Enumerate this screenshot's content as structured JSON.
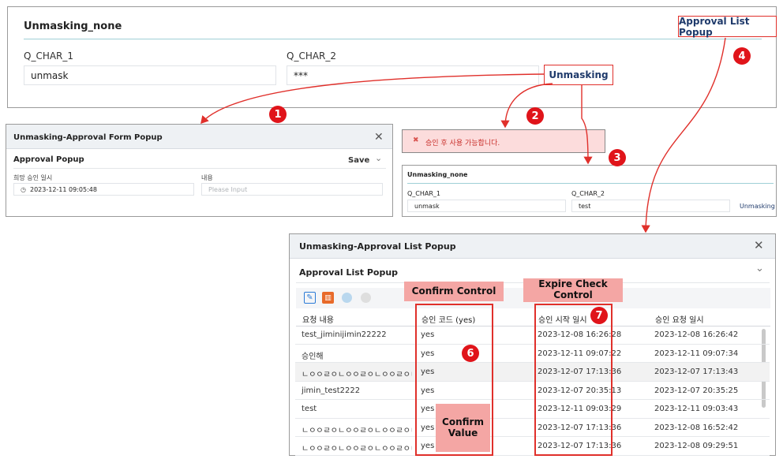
{
  "top_form": {
    "title": "Unmasking_none",
    "field1_label": "Q_CHAR_1",
    "field1_value": "unmask",
    "field2_label": "Q_CHAR_2",
    "field2_value": "***"
  },
  "annotations": {
    "approval_list_popup_btn": "Approval List Popup",
    "unmasking_btn": "Unmasking",
    "confirm_control": "Confirm Control",
    "expire_check_control": "Expire Check Control",
    "confirm_value": "Confirm Value",
    "badges": [
      "1",
      "2",
      "3",
      "4",
      "6",
      "7"
    ]
  },
  "form_popup": {
    "window_title": "Unmasking-Approval Form Popup",
    "section_title": "Approval Popup",
    "save_label": "Save",
    "date_label": "희망 승인 일시",
    "date_value": "2023-12-11 09:05:48",
    "content_label": "내용",
    "content_placeholder": "Please Input"
  },
  "error_toast": {
    "message": "승인 후 사용 가능합니다."
  },
  "unmasked_form": {
    "title": "Unmasking_none",
    "field1_label": "Q_CHAR_1",
    "field1_value": "unmask",
    "field2_label": "Q_CHAR_2",
    "field2_value": "test",
    "unmasking_label": "Unmasking"
  },
  "list_popup": {
    "window_title": "Unmasking-Approval List Popup",
    "section_title": "Approval List Popup",
    "columns": [
      "요청 내용",
      "승인 코드 (yes)",
      "승인 시작 일시",
      "승인 요청 일시"
    ],
    "rows": [
      [
        "test_jiminijimin22222",
        "yes",
        "2023-12-08 16:26:28",
        "2023-12-08 16:26:42"
      ],
      [
        "승인해",
        "yes",
        "2023-12-11 09:07:22",
        "2023-12-11 09:07:34"
      ],
      [
        "ㄴㅇㅇㄹㅇㄴㅇㅇㄹㅇㄴㅇㅇㄹㅇㄴㅇㅇㄹ",
        "yes",
        "2023-12-07 17:13:36",
        "2023-12-07 17:13:43"
      ],
      [
        "jimin_test2222",
        "yes",
        "2023-12-07 20:35:13",
        "2023-12-07 20:35:25"
      ],
      [
        "test",
        "yes",
        "2023-12-11 09:03:29",
        "2023-12-11 09:03:43"
      ],
      [
        "ㄴㅇㅇㄹㅇㄴㅇㅇㄹㅇㄴㅇㅇㄹㅇㄴㅇㅇㄹ",
        "yes",
        "2023-12-07 17:13:36",
        "2023-12-08 16:52:42"
      ],
      [
        "ㄴㅇㅇㄹㅇㄴㅇㅇㄹㅇㄴㅇㅇㄹㅇㄴㅇㅇㄹ",
        "yes",
        "2023-12-07 17:13:36",
        "2023-12-08 09:29:51"
      ]
    ]
  },
  "colors": {
    "accent_red": "#e0302b",
    "pink_label": "#f4a6a4",
    "link_blue": "#1f3a6b"
  }
}
